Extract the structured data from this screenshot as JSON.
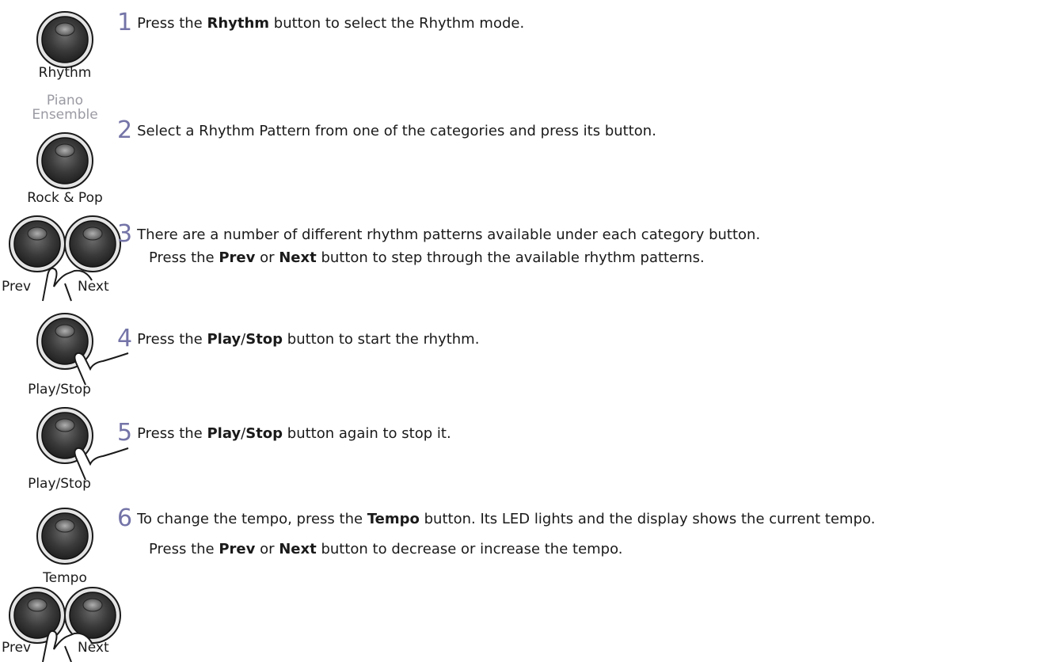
{
  "buttons": {
    "rhythm": "Rhythm",
    "piano_1": "Piano",
    "piano_2": "Ensemble",
    "rock_pop": "Rock & Pop",
    "prev": "Prev",
    "next": "Next",
    "play_stop": "Play/Stop",
    "tempo": "Tempo"
  },
  "steps": [
    {
      "num": "1",
      "a": "Press the ",
      "b1": "Rhythm",
      "c": " button to select the Rhythm mode."
    },
    {
      "num": "2",
      "a": "Select a Rhythm Pattern from one of the categories and press its button."
    },
    {
      "num": "3",
      "a": "There are a number of different rhythm patterns available under each category button.",
      "l2a": "Press the ",
      "l2b1": "Prev",
      "l2c": " or ",
      "l2b2": "Next",
      "l2d": " button to step through the available rhythm patterns."
    },
    {
      "num": "4",
      "a": "Press the ",
      "b1": "Play",
      "s": "/",
      "b2": "Stop",
      "c": " button to start the rhythm."
    },
    {
      "num": "5",
      "a": "Press the ",
      "b1": "Play",
      "s": "/",
      "b2": "Stop",
      "c": " button again to stop it."
    },
    {
      "num": "6",
      "a": "To change the tempo, press the ",
      "b1": "Tempo",
      "c": " button. Its LED lights and the display shows the current tempo.",
      "l2a": "Press the ",
      "l2b1": "Prev",
      "l2c": " or ",
      "l2b2": "Next",
      "l2d": " button to decrease or increase the tempo."
    }
  ]
}
